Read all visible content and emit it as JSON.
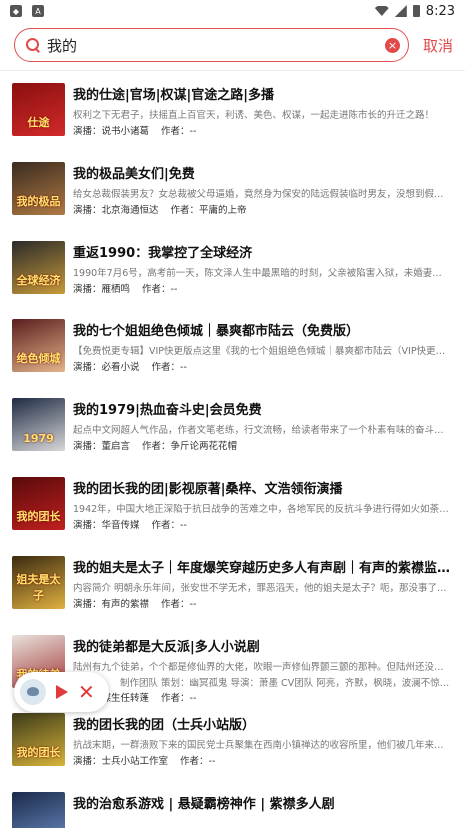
{
  "status_bar": {
    "time": "8:23",
    "left_icons": [
      "shield-icon",
      "app-a-icon"
    ],
    "right_icons": [
      "wifi-icon",
      "signal-icon",
      "battery-icon"
    ]
  },
  "search": {
    "query": "我的",
    "cancel_label": "取消",
    "accent": "#e24a4a"
  },
  "labels": {
    "narrator_prefix": "演播：",
    "author_prefix": "作者："
  },
  "results": [
    {
      "title": "我的仕途|官场|权谋|官途之路|多播",
      "desc": "权利之下无君子，扶摇直上百官天，利诱、美色、权谋，一起走进陈市长的升迁之路！",
      "narrator": "说书小诸葛",
      "author": "--",
      "cover_text": "仕途",
      "cover_colors": [
        "#8a0f0f",
        "#d22a2a"
      ]
    },
    {
      "title": "我的极品美女们|免费",
      "desc": "给女总裁假装男友？女总裁被父母逼婚，竟然身为保安的陆远假装临时男友，没想到假戏真…",
      "narrator": "北京海通恒达",
      "author": "平庸的上帝",
      "cover_text": "我的极品",
      "cover_colors": [
        "#3a2b1f",
        "#b07a44"
      ]
    },
    {
      "title": "重返1990：我掌控了全球经济",
      "desc": "1990年7月6号，高考前一天，陈文泽人生中最黑暗的时刻，父亲被陷害入狱，未婚妻上门悔…",
      "narrator": "雁栖鸣",
      "author": "--",
      "cover_text": "全球经济",
      "cover_colors": [
        "#2a2a2a",
        "#c79a3a"
      ]
    },
    {
      "title": "我的七个姐姐绝色倾城｜暴爽都市陆云（免费版）",
      "desc": "【免费悦更专辑】VIP快更版点这里《我的七个姐姐绝色倾城｜暴爽都市陆云（VIP快更版）》…",
      "narrator": "必看小说",
      "author": "--",
      "cover_text": "绝色倾城",
      "cover_colors": [
        "#5a1e1e",
        "#e3b48a"
      ]
    },
    {
      "title": "我的1979|热血奋斗史|会员免费",
      "desc": "起点中文网超人气作品，作者文笔老练，行文流畅，给读者带来了一个朴素有味的奋斗史，仿…",
      "narrator": "董启言",
      "author": "争斤论两花花帽",
      "cover_text": "1979",
      "cover_colors": [
        "#1e2a44",
        "#d8d8d8"
      ]
    },
    {
      "title": "我的团长我的团|影视原著|桑梓、文浩领衔演播",
      "desc": "1942年，中国大地正深陷于抗日战争的苦难之中，各地军民的反抗斗争进行得如火如荼……在…",
      "narrator": "华音传媒",
      "author": "--",
      "cover_text": "我的团长",
      "cover_colors": [
        "#5a0a0a",
        "#c02020"
      ]
    },
    {
      "title": "我的姐夫是太子｜年度爆笑穿越历史多人有声剧｜有声的紫襟监制作品",
      "desc": "内容简介 明朝永乐年间，张安世不学无术，罪恶滔天，他的姐夫是太子？呃，那没事了！CAS…",
      "narrator": "有声的紫襟",
      "author": "--",
      "cover_text": "姐夫是太子",
      "cover_colors": [
        "#3a2a10",
        "#e0b040"
      ]
    },
    {
      "title": "我的徒弟都是大反派|多人小说剧",
      "desc": "陆州有九个徒弟，个个都是修仙界的大佬，吹眼一声修仙界颤三颤的那种。但陆州还没来得及…",
      "desc2": "制作团队 策划：幽冥孤鬼 导演：萧墨 CV团队 阿亮，齐默，枫晓，波澜不惊的一修，cv李白，oO拾安Oo，CV夜小萱，一陌",
      "narrator": "谋生任转蓬",
      "author": "--",
      "cover_text": "我的徒弟",
      "cover_colors": [
        "#e9e2dc",
        "#a23a3a"
      ]
    },
    {
      "title": "我的团长我的团（士兵小站版）",
      "desc": "抗战末期，一群溃败下来的国民党士兵聚集在西南小镇禅达的收容所里，他们被几年来国土渐…",
      "narrator": "士兵小站工作室",
      "author": "--",
      "cover_text": "我的团长",
      "cover_colors": [
        "#3c3a1a",
        "#d7b33a"
      ]
    },
    {
      "title": "我的治愈系游戏 | 悬疑霸榜神作 | 紫襟多人剧",
      "desc": "",
      "narrator": "",
      "author": "",
      "cover_text": "",
      "cover_colors": [
        "#1a2a4a",
        "#6a8ac0"
      ]
    }
  ]
}
